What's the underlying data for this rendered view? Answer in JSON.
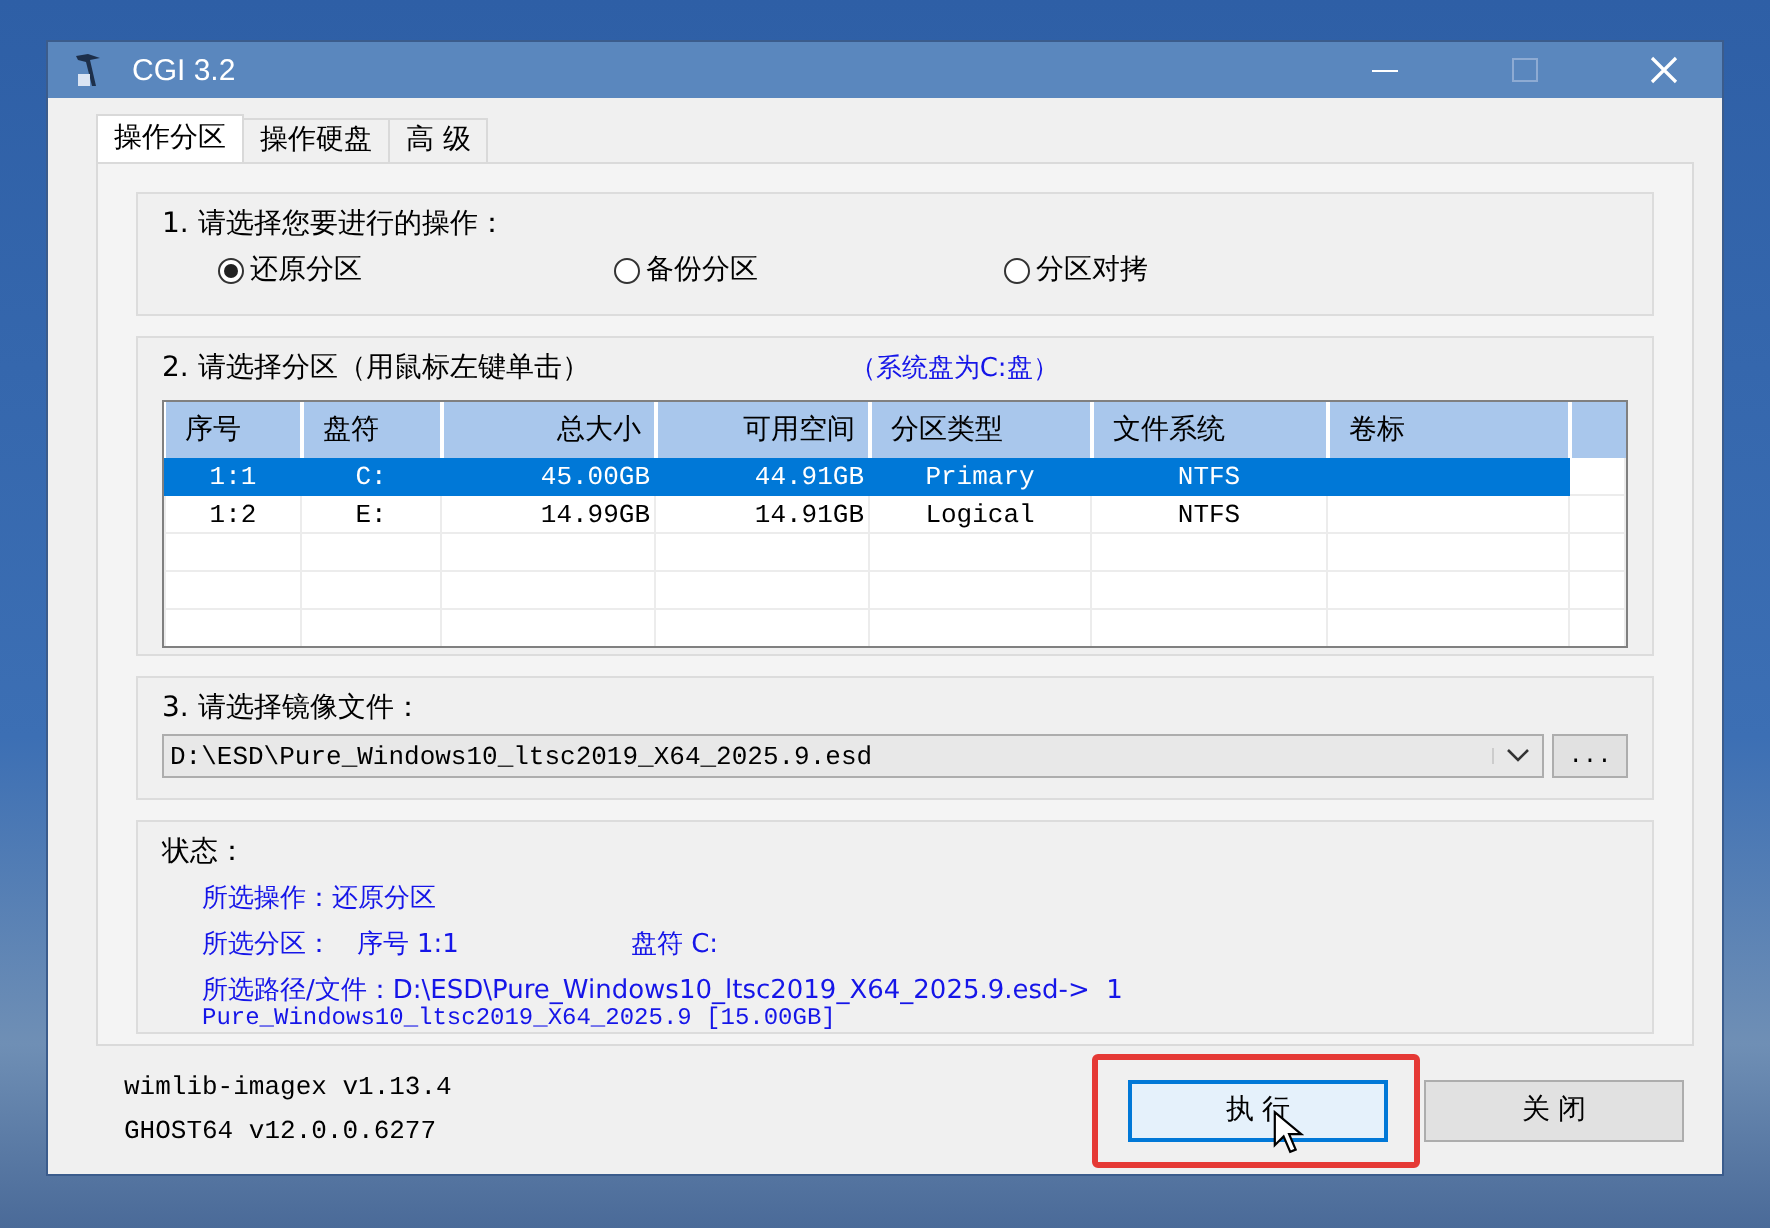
{
  "window": {
    "title": "CGI 3.2"
  },
  "tabs": [
    {
      "label": "操作分区",
      "selected": true
    },
    {
      "label": "操作硬盘",
      "selected": false
    },
    {
      "label": "高 级",
      "selected": false
    }
  ],
  "operation_group": {
    "label": "1. 请选择您要进行的操作：",
    "options": [
      {
        "label": "还原分区",
        "selected": true
      },
      {
        "label": "备份分区",
        "selected": false
      },
      {
        "label": "分区对拷",
        "selected": false
      }
    ]
  },
  "partition_group": {
    "label": "2. 请选择分区（用鼠标左键单击）",
    "note": "（系统盘为C:盘）",
    "table": {
      "columns": [
        "序号",
        "盘符",
        "总大小",
        "可用空间",
        "分区类型",
        "文件系统",
        "卷标"
      ],
      "rows": [
        {
          "cells": [
            "1:1",
            "C:",
            "45.00GB",
            "44.91GB",
            "Primary",
            "NTFS",
            ""
          ],
          "selected": true
        },
        {
          "cells": [
            "1:2",
            "E:",
            "14.99GB",
            "14.91GB",
            "Logical",
            "NTFS",
            ""
          ],
          "selected": false
        }
      ]
    }
  },
  "image_group": {
    "label": "3. 请选择镜像文件：",
    "file": {
      "value": "D:\\ESD\\Pure_Windows10_ltsc2019_X64_2025.9.esd"
    },
    "browse_button": "..."
  },
  "status": {
    "label": "状态：",
    "lines": [
      [
        "所选操作：还原分区"
      ],
      [
        "所选分区：   序号 1:1",
        "盘符 C:"
      ],
      [
        "所选路径/文件：D:\\ESD\\Pure_Windows10_ltsc2019_X64_2025.9.esd->  1"
      ],
      [
        "Pure_Windows10_ltsc2019_X64_2025.9 [15.00GB]"
      ]
    ]
  },
  "versions": [
    "wimlib-imagex v1.13.4",
    "GHOST64 v12.0.0.6277"
  ],
  "buttons": [
    {
      "label": "执 行",
      "focused": true,
      "highlighted": true
    },
    {
      "label": "关 闭",
      "focused": false,
      "highlighted": false
    }
  ]
}
